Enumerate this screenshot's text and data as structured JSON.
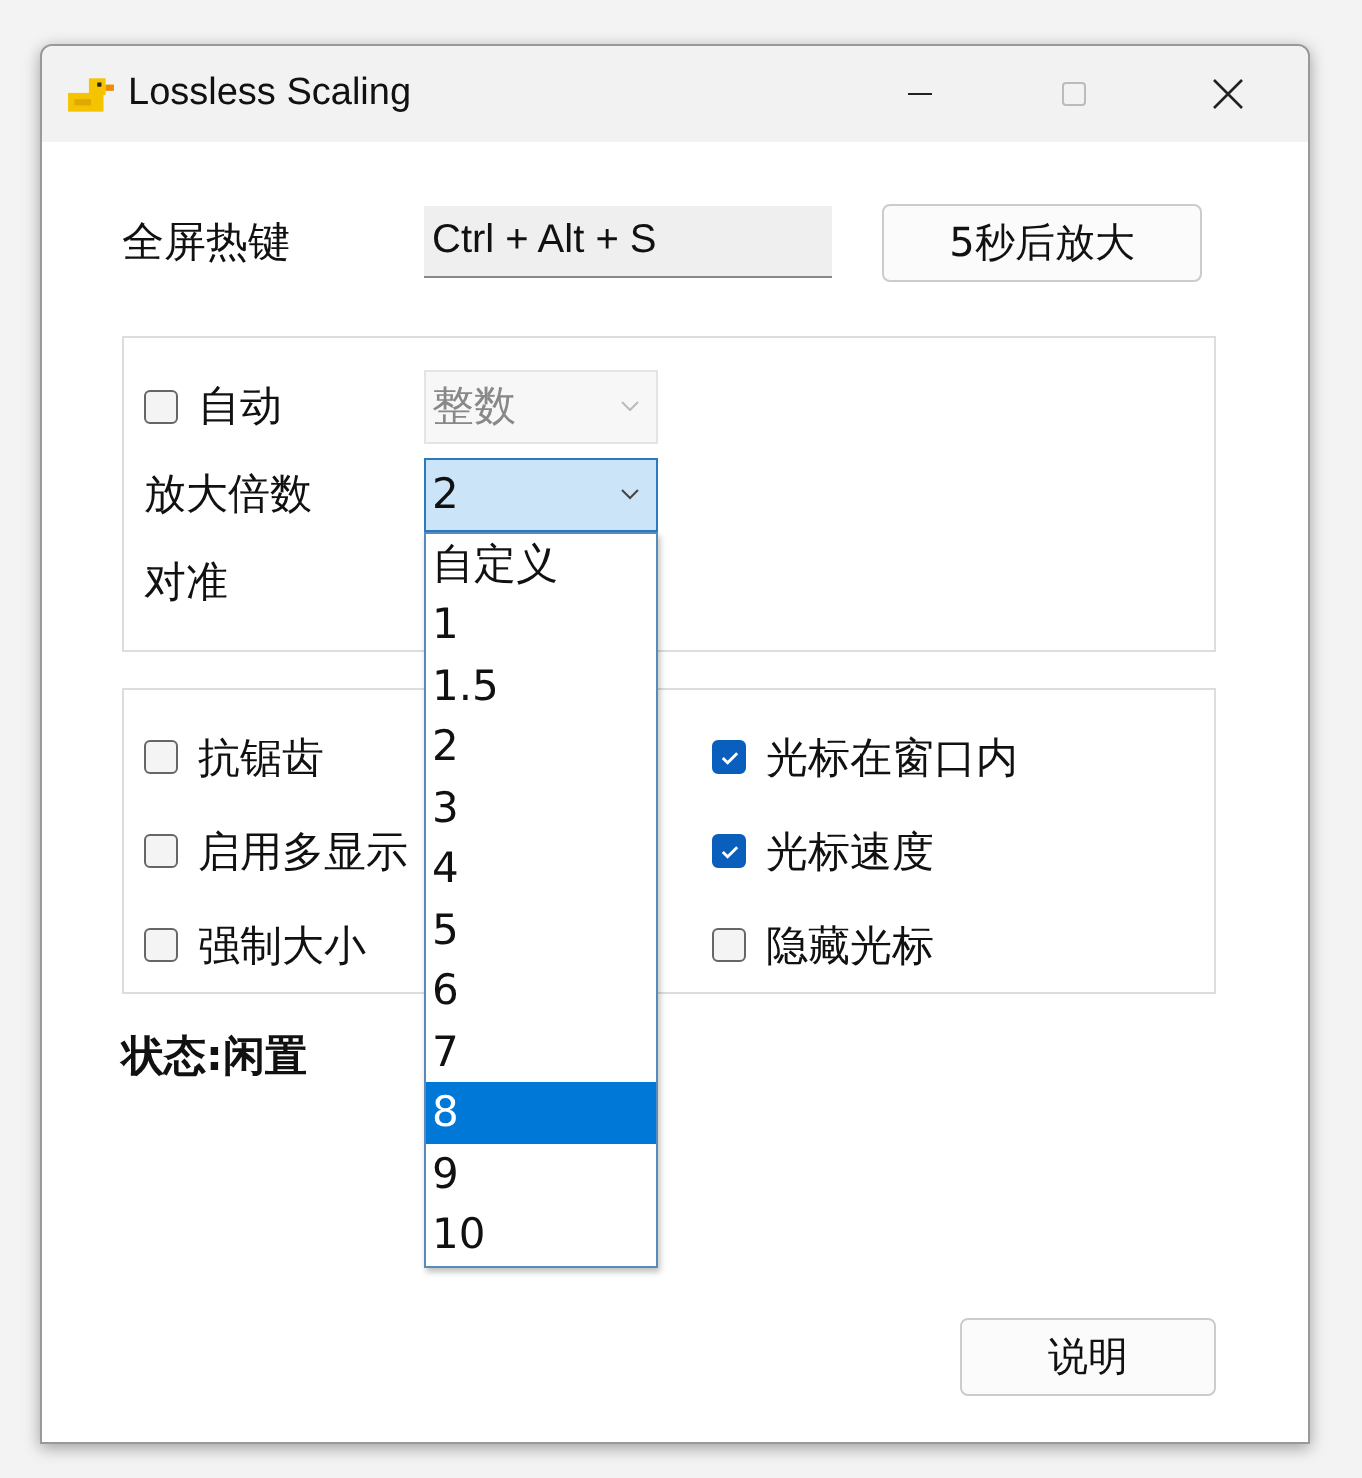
{
  "window": {
    "title": "Lossless Scaling"
  },
  "hotkey": {
    "label": "全屏热键",
    "value": "Ctrl + Alt + S"
  },
  "delay_button": "5秒后放大",
  "scaling_group": {
    "auto": {
      "label": "自动",
      "checked": false
    },
    "mode_combo": {
      "value": "整数",
      "disabled": true
    },
    "factor_label": "放大倍数",
    "factor_combo": {
      "value": "2",
      "expanded": true
    },
    "align_label": "对准"
  },
  "dropdown_options": [
    {
      "label": "自定义",
      "selected": false
    },
    {
      "label": "1",
      "selected": false
    },
    {
      "label": "1.5",
      "selected": false
    },
    {
      "label": "2",
      "selected": false
    },
    {
      "label": "3",
      "selected": false
    },
    {
      "label": "4",
      "selected": false
    },
    {
      "label": "5",
      "selected": false
    },
    {
      "label": "6",
      "selected": false
    },
    {
      "label": "7",
      "selected": false
    },
    {
      "label": "8",
      "selected": true
    },
    {
      "label": "9",
      "selected": false
    },
    {
      "label": "10",
      "selected": false
    }
  ],
  "options": [
    {
      "label": "抗锯齿",
      "checked": false
    },
    {
      "label": "光标在窗口内",
      "checked": true
    },
    {
      "label": "启用多显示",
      "checked": false
    },
    {
      "label": "光标速度",
      "checked": true
    },
    {
      "label": "强制大小",
      "checked": false
    },
    {
      "label": "隐藏光标",
      "checked": false
    }
  ],
  "status": "状态:闲置",
  "help_button": "说明"
}
